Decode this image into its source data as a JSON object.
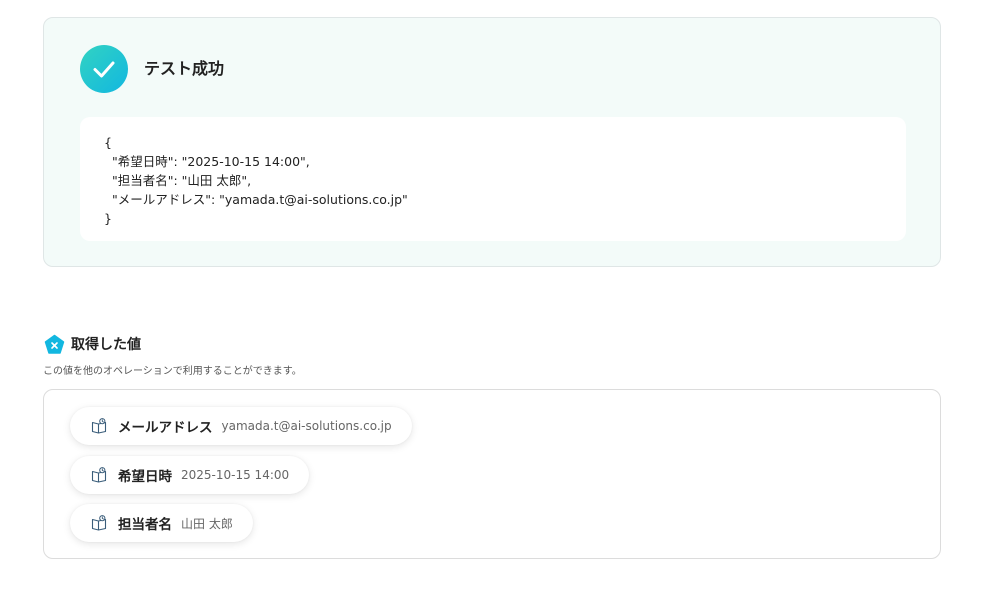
{
  "result": {
    "title": "テスト成功",
    "json_text": "{\n  \"希望日時\": \"2025-10-15 14:00\",\n  \"担当者名\": \"山田 太郎\",\n  \"メールアドレス\": \"yamada.t@ai-solutions.co.jp\"\n}"
  },
  "values": {
    "title": "取得した値",
    "description": "この値を他のオペレーションで利用することができます。",
    "items": [
      {
        "key": "メールアドレス",
        "value": "yamada.t@ai-solutions.co.jp"
      },
      {
        "key": "希望日時",
        "value": "2025-10-15 14:00"
      },
      {
        "key": "担当者名",
        "value": "山田 太郎"
      }
    ]
  },
  "colors": {
    "accent_start": "#32d3c2",
    "accent_end": "#12b7e0",
    "card_background": "#f3fbf9"
  },
  "icons": {
    "success": "check-icon",
    "values_header": "pentagon-x-icon",
    "chip": "variable-book-icon"
  }
}
